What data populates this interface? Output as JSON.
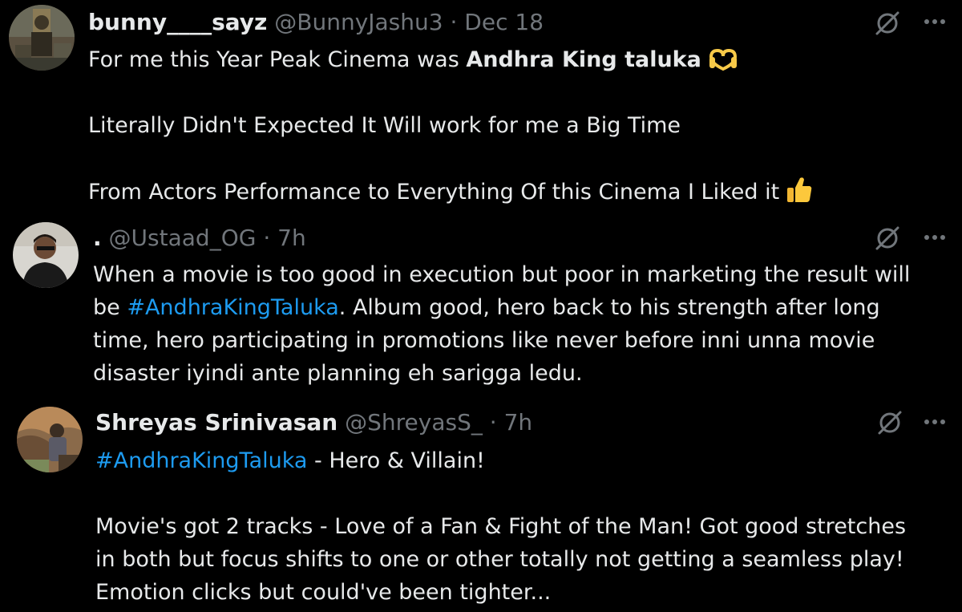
{
  "tweets": [
    {
      "name": "bunny____sayz",
      "handle": "@BunnyJashu3",
      "separator": "·",
      "time": "Dec 18",
      "text": {
        "line1_prefix": "For me this Year Peak Cinema was ",
        "line1_bold": "Andhra King taluka",
        "line2": "Literally Didn't Expected It Will work for me a Big Time",
        "line3": "From Actors Performance to Everything Of this Cinema I Liked it"
      },
      "icons": [
        "grok-icon",
        "more-icon",
        "heart-hands-emoji",
        "thumbs-up-emoji"
      ]
    },
    {
      "name": ".",
      "handle": "@Ustaad_OG",
      "separator": "·",
      "time": "7h",
      "text": {
        "line1": "When a movie is too good in execution but poor in marketing the result will",
        "line2_prefix": "be ",
        "hashtag": "#AndhraKingTaluka",
        "line2_suffix": ". Album good, hero back to his strength after long",
        "line3": "time, hero participating in promotions like never before inni unna movie",
        "line4": "disaster iyindi ante planning eh sarigga ledu."
      },
      "icons": [
        "grok-icon",
        "more-icon"
      ]
    },
    {
      "name": "Shreyas Srinivasan",
      "handle": "@ShreyasS_",
      "separator": "·",
      "time": "7h",
      "text": {
        "hashtag": "#AndhraKingTaluka",
        "line1_suffix": " - Hero & Villain!",
        "line2": "Movie's got 2 tracks - Love of a Fan & Fight of the Man! Got good stretches",
        "line3": "in both but focus shifts to one or other totally not getting a seamless play!",
        "line4": "Emotion clicks but could've been tighter..."
      },
      "icons": [
        "grok-icon",
        "more-icon"
      ]
    }
  ],
  "colors": {
    "background": "#000000",
    "text": "#e7e9ea",
    "secondary": "#71767b",
    "link": "#1d9bf0"
  }
}
